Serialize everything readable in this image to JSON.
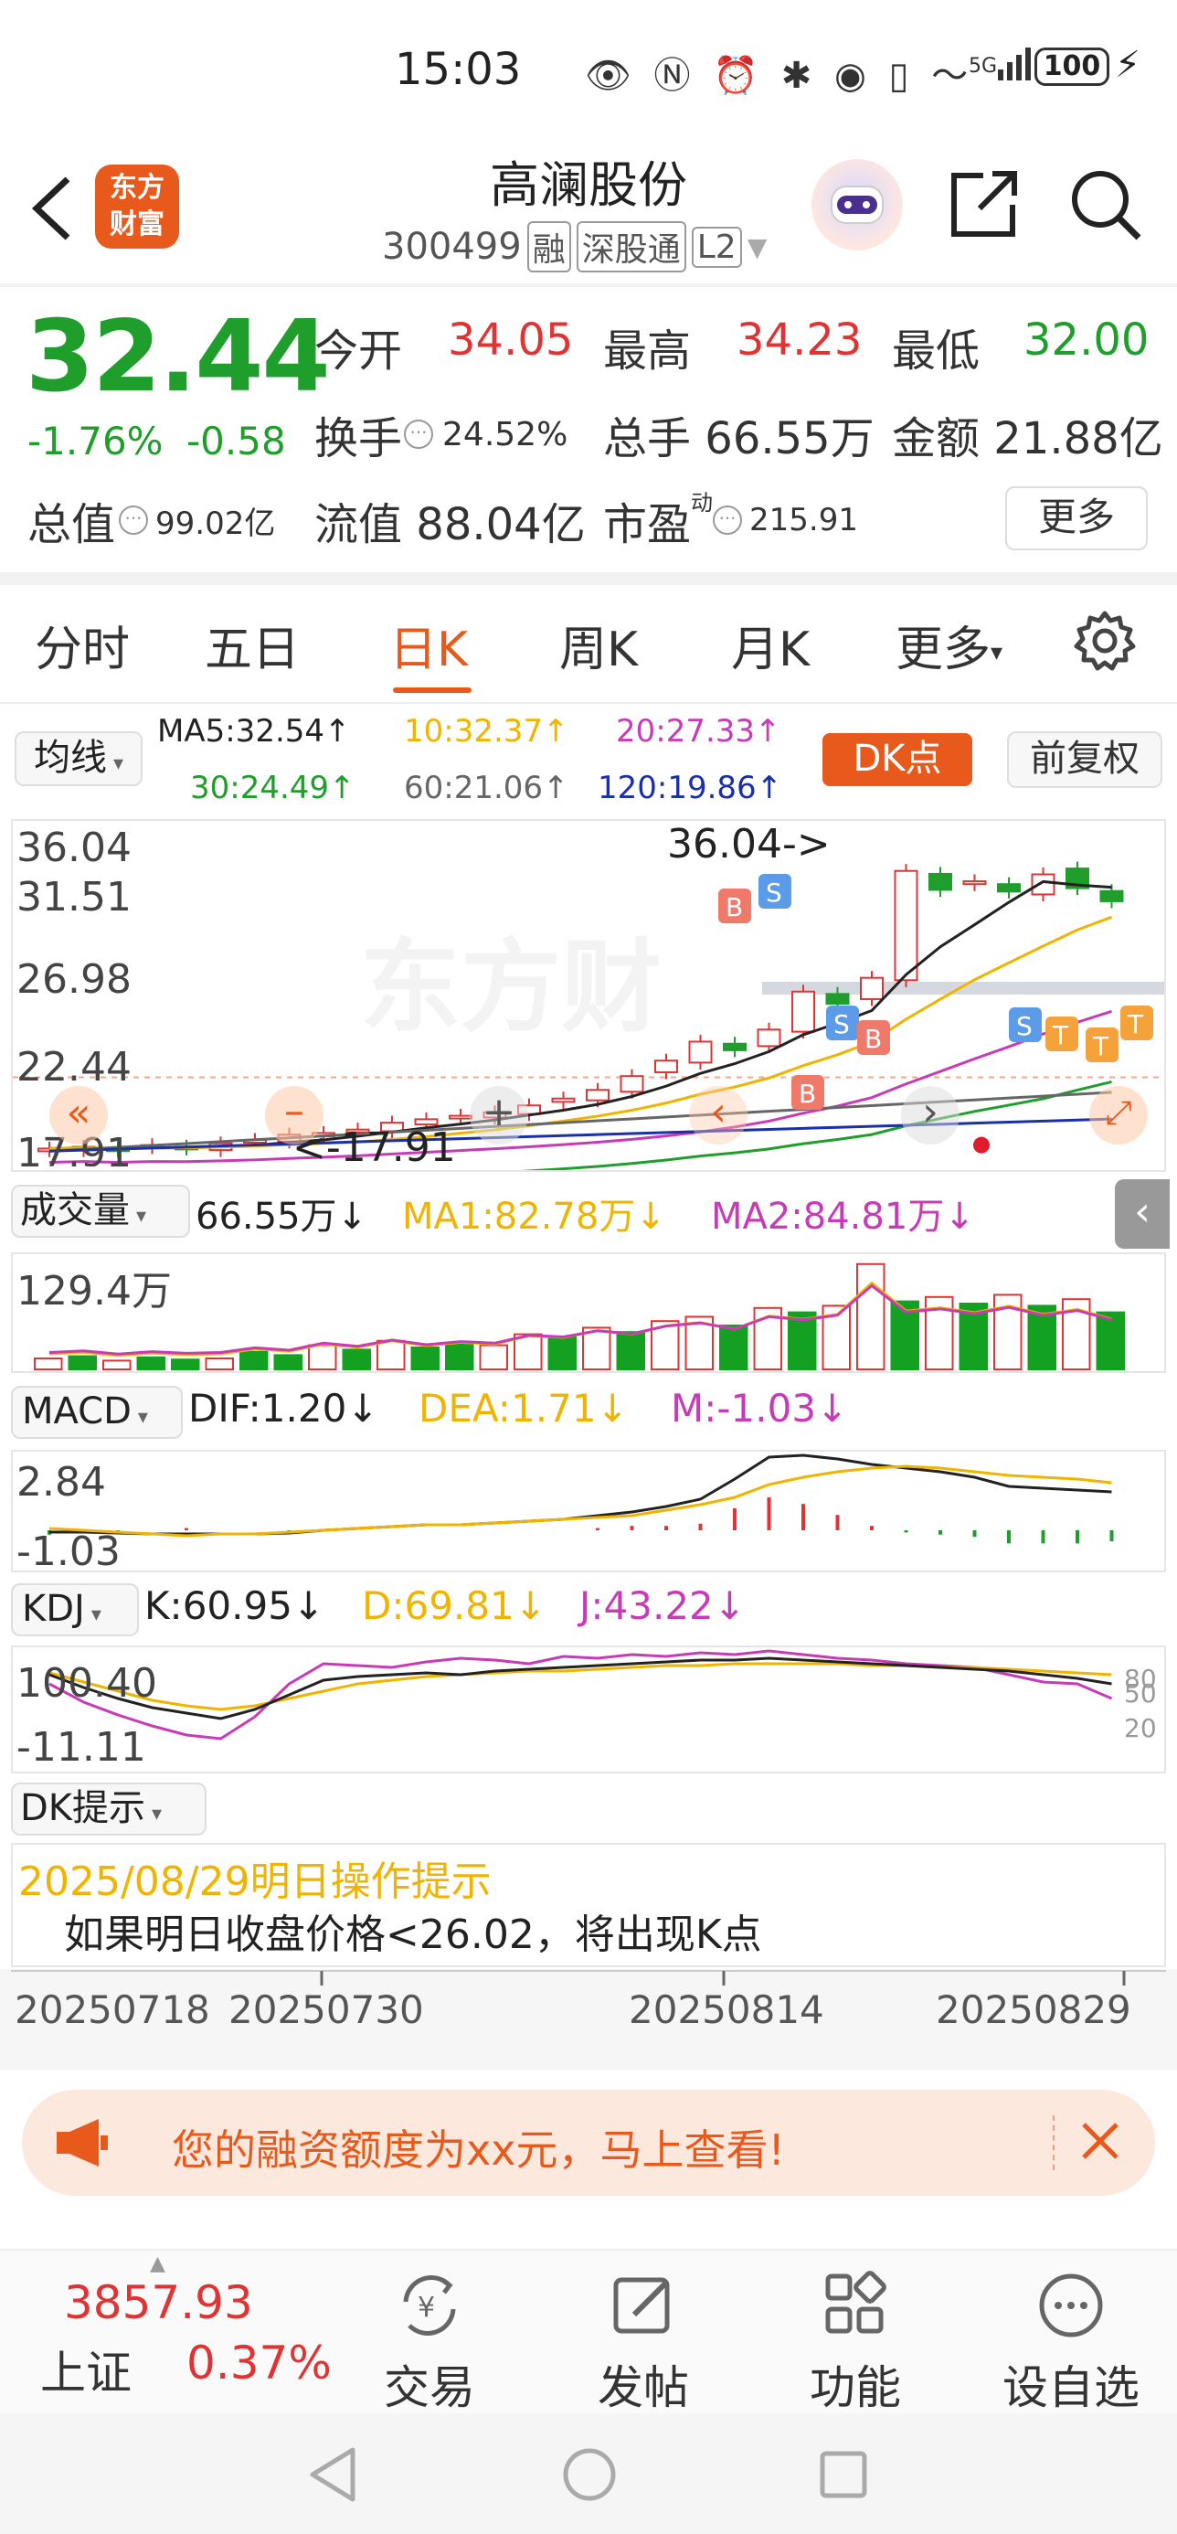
{
  "status": {
    "time": "15:03",
    "battery": "100",
    "network": "5G"
  },
  "header": {
    "title": "高澜股份",
    "code": "300499",
    "tags": [
      "融",
      "深股通",
      "L2"
    ],
    "logo_line1": "东方",
    "logo_line2": "财富"
  },
  "quote": {
    "price": "32.44",
    "change_pct": "-1.76%",
    "change": "-0.58",
    "open_label": "今开",
    "open": "34.05",
    "high_label": "最高",
    "high": "34.23",
    "low_label": "最低",
    "low": "32.00",
    "turnover_label": "换手",
    "turnover": "24.52%",
    "volume_label": "总手",
    "volume": "66.55万",
    "amount_label": "金额",
    "amount": "21.88亿",
    "mcap_label": "总值",
    "mcap": "99.02亿",
    "float_label": "流值",
    "float": "88.04亿",
    "pe_label": "市盈",
    "pe_sup": "动",
    "pe": "215.91",
    "more_button": "更多"
  },
  "tabs": [
    "分时",
    "五日",
    "日K",
    "周K",
    "月K",
    "更多"
  ],
  "chart_header": {
    "ma_dropdown": "均线",
    "ma5": "MA5:32.54↑",
    "ma10": "10:32.37↑",
    "ma20": "20:27.33↑",
    "ma30": "30:24.49↑",
    "ma60": "60:21.06↑",
    "ma120": "120:19.86↑",
    "dk_button": "DK点",
    "adjust_button": "前复权"
  },
  "kline": {
    "y_labels": [
      "36.04",
      "31.51",
      "26.98",
      "22.44",
      "17.91"
    ],
    "high_annotation": "36.04->",
    "low_annotation": "<-17.91",
    "watermark": "东方财"
  },
  "volume": {
    "dropdown": "成交量",
    "value": "66.55万↓",
    "ma1": "MA1:82.78万↓",
    "ma2": "MA2:84.81万↓",
    "max_label": "129.4万"
  },
  "macd": {
    "dropdown": "MACD",
    "dif": "DIF:1.20↓",
    "dea": "DEA:1.71↓",
    "m": "M:-1.03↓",
    "top": "2.84",
    "bottom": "-1.03"
  },
  "kdj": {
    "dropdown": "KDJ",
    "k": "K:60.95↓",
    "d": "D:69.81↓",
    "j": "J:43.22↓",
    "top": "100.40",
    "bottom": "-11.11",
    "r80": "80",
    "r50": "50",
    "r20": "20"
  },
  "dk_tip": {
    "dropdown": "DK提示",
    "title": "2025/08/29明日操作提示",
    "content": "如果明日收盘价格<26.02，将出现K点"
  },
  "x_dates": [
    "20250718",
    "20250730",
    "20250814",
    "20250829"
  ],
  "banner": {
    "text": "您的融资额度为xx元，马上查看!"
  },
  "bottom": {
    "index_value": "3857.93",
    "index_name": "上证",
    "index_change": "0.37%",
    "nav": [
      "交易",
      "发帖",
      "功能",
      "设自选"
    ]
  },
  "colors": {
    "up": "#e03434",
    "down": "#1f9e2c",
    "accent": "#e8591c",
    "ma10": "#f0b400",
    "ma20": "#c73bb6"
  }
}
